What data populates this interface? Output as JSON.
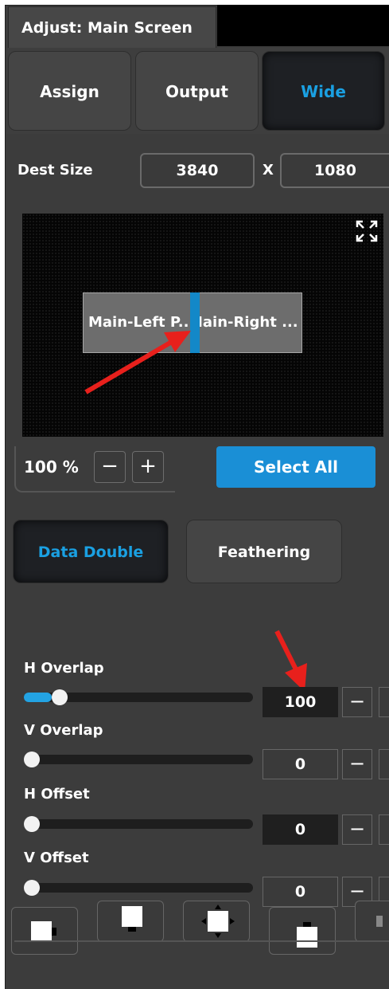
{
  "title": "Adjust: Main Screen",
  "tabs": [
    {
      "label": "Assign",
      "active": false
    },
    {
      "label": "Output",
      "active": false
    },
    {
      "label": "Wide",
      "active": true
    }
  ],
  "dest_size": {
    "label": "Dest Size",
    "width": "3840",
    "separator": "X",
    "height": "1080"
  },
  "canvas": {
    "fullscreen_icon": "expand-arrows-icon",
    "layers": [
      {
        "label": "Main-Left P..."
      },
      {
        "label": "Main-Right ..."
      }
    ]
  },
  "zoom": {
    "label": "100 %",
    "minus": "−",
    "plus": "+"
  },
  "select_all_label": "Select All",
  "modes": [
    {
      "label": "Data Double",
      "active": true
    },
    {
      "label": "Feathering",
      "active": false
    }
  ],
  "sliders": [
    {
      "label": "H Overlap",
      "value": "100",
      "fraction": 0.12,
      "minus": "−"
    },
    {
      "label": "V Overlap",
      "value": "0",
      "fraction": 0.0,
      "minus": "−"
    },
    {
      "label": "H Offset",
      "value": "0",
      "fraction": 0.0,
      "minus": "−"
    },
    {
      "label": "V Offset",
      "value": "0",
      "fraction": 0.0,
      "minus": "−"
    }
  ],
  "align_buttons": [
    {
      "icon": "align-right-icon"
    },
    {
      "icon": "align-bottom-icon"
    },
    {
      "icon": "align-center-icon"
    },
    {
      "icon": "align-top-icon"
    },
    {
      "icon": "align-more-icon"
    }
  ],
  "colors": {
    "accent": "#1a8fd6",
    "annotation": "#e8201c"
  }
}
